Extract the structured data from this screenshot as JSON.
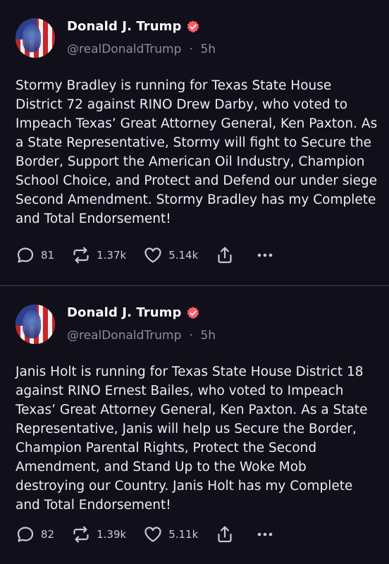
{
  "posts": [
    {
      "author": "Donald J. Trump",
      "handle": "@realDonaldTrump",
      "separator": "·",
      "time": "5h",
      "text": "Stormy Bradley is running for Texas State House District 72 against RINO Drew Darby, who voted to Impeach Texas’ Great Attorney General, Ken Paxton. As a State Representative, Stormy will fight to Secure the Border, Support the American Oil Industry, Champion School Choice, and Protect and Defend our under siege Second Amendment. Stormy Bradley has my Complete and Total Endorsement!",
      "replies": "81",
      "reposts": "1.37k",
      "likes": "5.14k"
    },
    {
      "author": "Donald J. Trump",
      "handle": "@realDonaldTrump",
      "separator": "·",
      "time": "5h",
      "text": "Janis Holt is running for Texas State House District 18 against RINO Ernest Bailes, who voted to Impeach Texas’ Great Attorney General, Ken Paxton. As a State Representative, Janis will help us Secure the Border, Champion Parental Rights, Protect the Second Amendment, and Stand Up to the Woke Mob destroying our Country. Janis Holt has my Complete and Total Endorsement!",
      "replies": "82",
      "reposts": "1.39k",
      "likes": "5.11k"
    }
  ],
  "colors": {
    "background": "#100f1a",
    "verified_badge": "#ff5a67",
    "muted_text": "#8e8ba1",
    "divider": "#2b2a38"
  },
  "icons": {
    "verified": "verified-badge-icon",
    "reply": "reply-bubble-icon",
    "repost": "repost-arrows-icon",
    "like": "heart-icon",
    "share": "share-upload-icon",
    "more": "more-dots-icon"
  }
}
